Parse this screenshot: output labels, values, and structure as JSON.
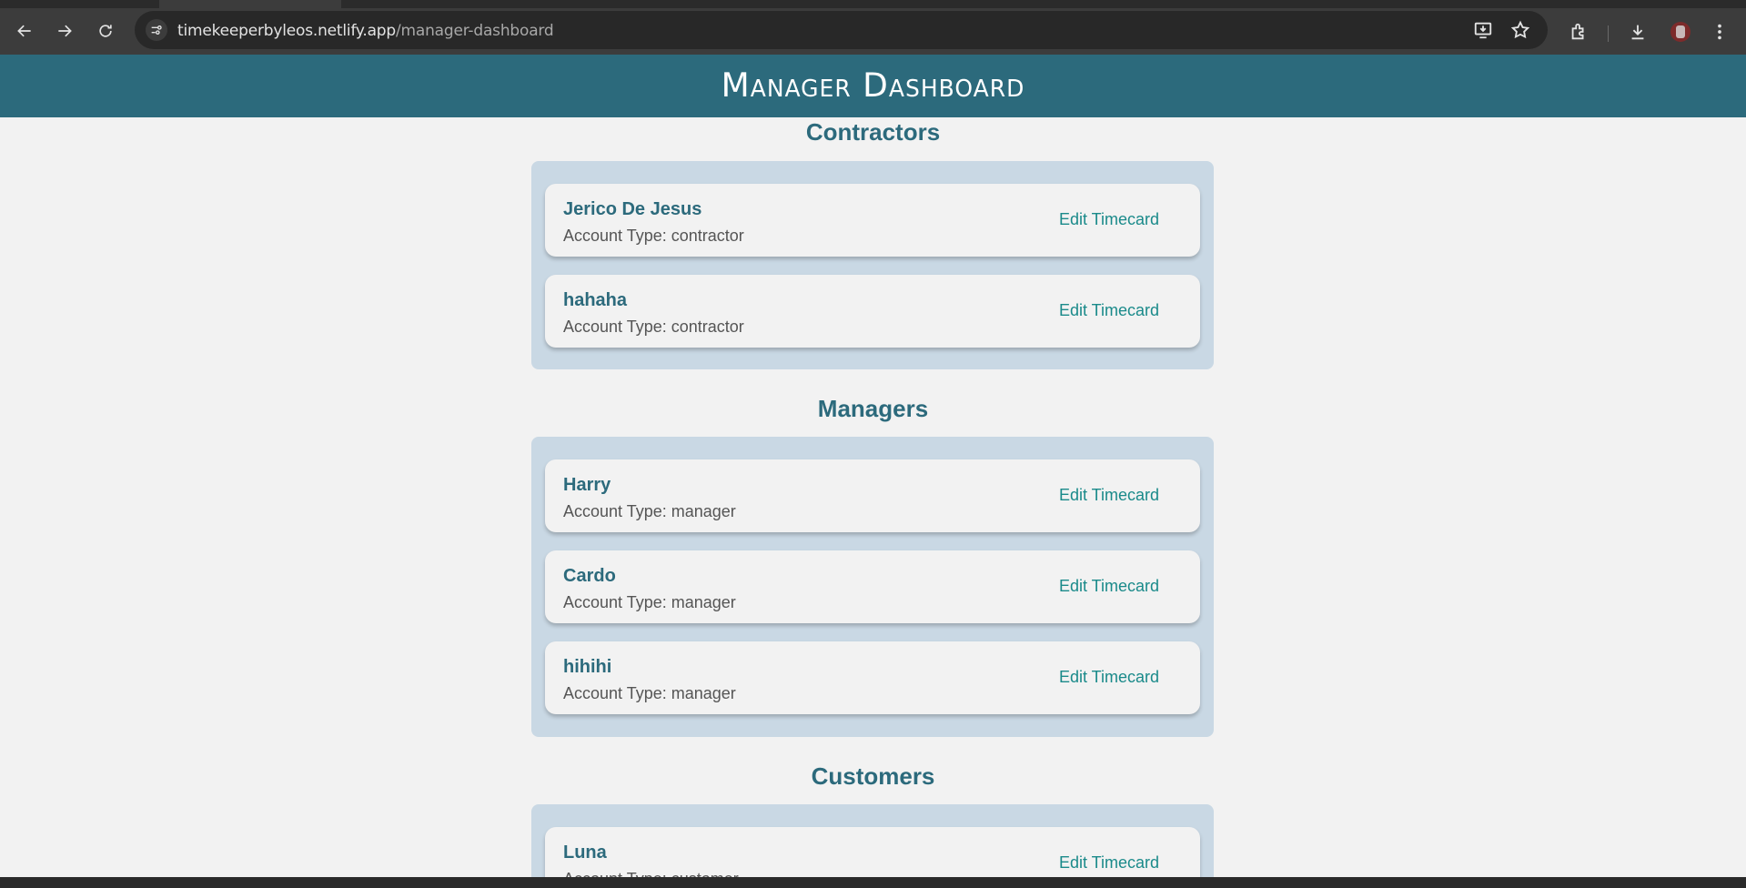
{
  "browser": {
    "url_host": "timekeeperbyleos.netlify.app",
    "url_path": "/manager-dashboard"
  },
  "header": {
    "title": "Manager Dashboard"
  },
  "sections": [
    {
      "title": "Contractors",
      "users": [
        {
          "name": "Jerico De Jesus",
          "account": "Account Type: contractor",
          "action": "Edit Timecard"
        },
        {
          "name": "hahaha",
          "account": "Account Type: contractor",
          "action": "Edit Timecard"
        }
      ]
    },
    {
      "title": "Managers",
      "users": [
        {
          "name": "Harry",
          "account": "Account Type: manager",
          "action": "Edit Timecard"
        },
        {
          "name": "Cardo",
          "account": "Account Type: manager",
          "action": "Edit Timecard"
        },
        {
          "name": "hihihi",
          "account": "Account Type: manager",
          "action": "Edit Timecard"
        }
      ]
    },
    {
      "title": "Customers",
      "users": [
        {
          "name": "Luna",
          "account": "Account Type: customer",
          "action": "Edit Timecard"
        }
      ]
    }
  ],
  "colors": {
    "header_bg": "#2c6a7c",
    "accent_text": "#2c6a7c",
    "link": "#1a8a8a",
    "group_bg": "#c9d8e4",
    "page_bg": "#f2f2f2"
  }
}
